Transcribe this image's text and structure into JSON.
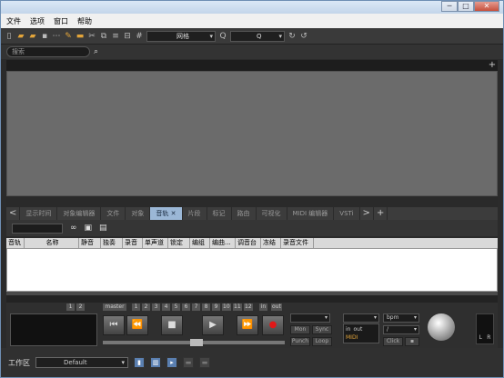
{
  "menu": [
    "文件",
    "选项",
    "窗口",
    "帮助"
  ],
  "toolbar": {
    "snap_label": "网格",
    "quantize_label": "Q"
  },
  "search": {
    "placeholder": "搜索"
  },
  "tabs": [
    {
      "label": "显示时间",
      "active": false
    },
    {
      "label": "对象编辑器",
      "active": false
    },
    {
      "label": "文件",
      "active": false
    },
    {
      "label": "对象",
      "active": false
    },
    {
      "label": "音轨",
      "active": true
    },
    {
      "label": "片段",
      "active": false
    },
    {
      "label": "标记",
      "active": false
    },
    {
      "label": "路由",
      "active": false
    },
    {
      "label": "可视化",
      "active": false
    },
    {
      "label": "MIDI 编辑器",
      "active": false
    },
    {
      "label": "VSTi",
      "active": false
    }
  ],
  "table": {
    "headers": [
      "音轨",
      "名称",
      "静音",
      "独奏",
      "录音",
      "单声道",
      "锁定",
      "编组",
      "编曲...",
      "调音台",
      "冻结",
      "录音文件"
    ]
  },
  "transport": {
    "numbers": [
      "1",
      "2",
      "master",
      "1",
      "2",
      "3",
      "4",
      "5",
      "6",
      "7",
      "8",
      "9",
      "10",
      "11",
      "12",
      "in",
      "out"
    ],
    "buttons": {
      "mon": "Mon",
      "sync": "Sync",
      "punch": "Punch",
      "loop": "Loop",
      "click": "Click"
    },
    "bpm_label": "bpm",
    "signature_label": "/",
    "midi": {
      "in": "in",
      "out": "out",
      "label": "MIDI"
    },
    "meter_labels": [
      "L",
      "R"
    ]
  },
  "status": {
    "workspace_label": "工作区",
    "workspace_value": "Default"
  }
}
